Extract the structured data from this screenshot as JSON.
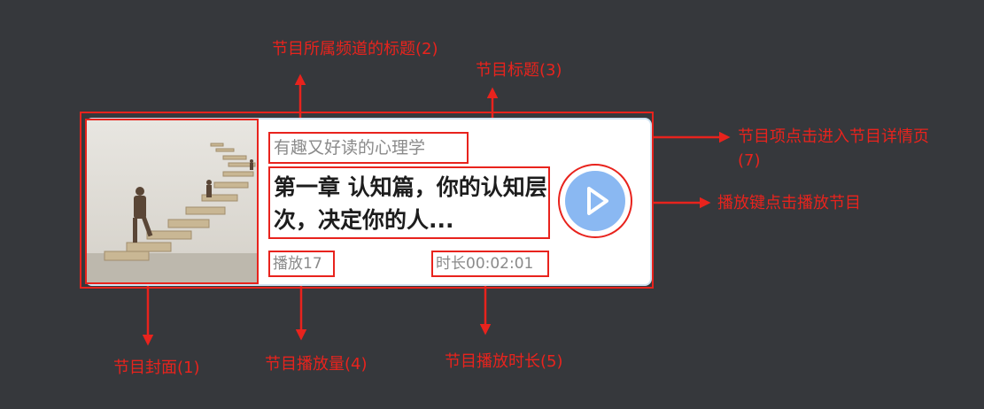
{
  "card": {
    "channel_title": "有趣又好读的心理学",
    "program_title": "第一章 认知篇，你的认知层次，决定你的人...",
    "plays": "播放17",
    "duration": "时长00:02:01"
  },
  "annotations": {
    "channel": "节目所属频道的标题(2)",
    "title": "节目标题(3)",
    "item_click_line1": "节目项点击进入节目详情页",
    "item_click_line2": "(7)",
    "play_button": "播放键点击播放节目",
    "cover": "节目封面(1)",
    "plays": "节目播放量(4)",
    "duration": "节目播放时长(5)"
  },
  "colors": {
    "background": "#36383c",
    "annotation": "#e8231d",
    "play_button": "#8ab8f2",
    "card_border": "#cfe2f1"
  },
  "icons": [
    "play-icon",
    "arrow-icon"
  ]
}
